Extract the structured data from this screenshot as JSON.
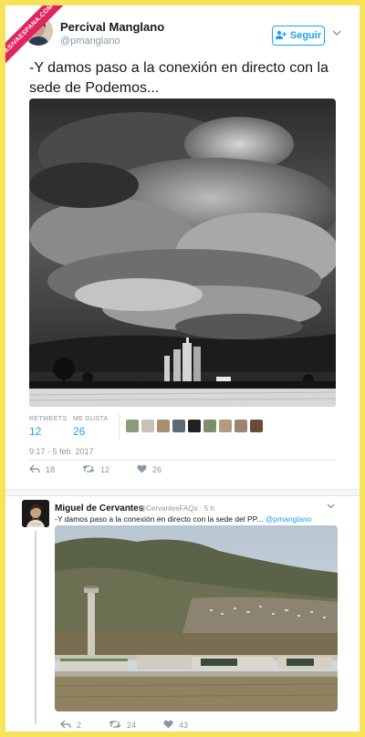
{
  "watermark": {
    "text": "ASIVAESPANA.COM"
  },
  "tweet1": {
    "author_name": "Percival Manglano",
    "author_handle": "@pmanglano",
    "follow_label": "Seguir",
    "text": "-Y damos paso a la conexión en directo con la sede de Podemos...",
    "retweets_label": "RETWEETS",
    "retweets_count": "12",
    "likes_label": "ME GUSTA",
    "likes_count": "26",
    "timestamp": "9:17 - 5 feb. 2017",
    "actions": {
      "reply": "18",
      "retweet": "12",
      "like": "26"
    }
  },
  "tweet2": {
    "author_name": "Miguel de Cervantes",
    "author_handle": "@CervantesFAQs · 5 h",
    "text": "-Y damos paso a la conexión en directo con la sede del PP...",
    "mention": "@pmanglano",
    "actions": {
      "reply": "2",
      "retweet": "24",
      "like": "43"
    }
  },
  "icons": {
    "follow": "add-user-icon",
    "menu": "chevron-down-icon",
    "reply": "reply-icon",
    "retweet": "retweet-icon",
    "like": "heart-icon"
  },
  "colors": {
    "accent": "#1da1f2",
    "muted": "#8899a6",
    "background": "#f7e35a",
    "badge": "#e0245e"
  }
}
